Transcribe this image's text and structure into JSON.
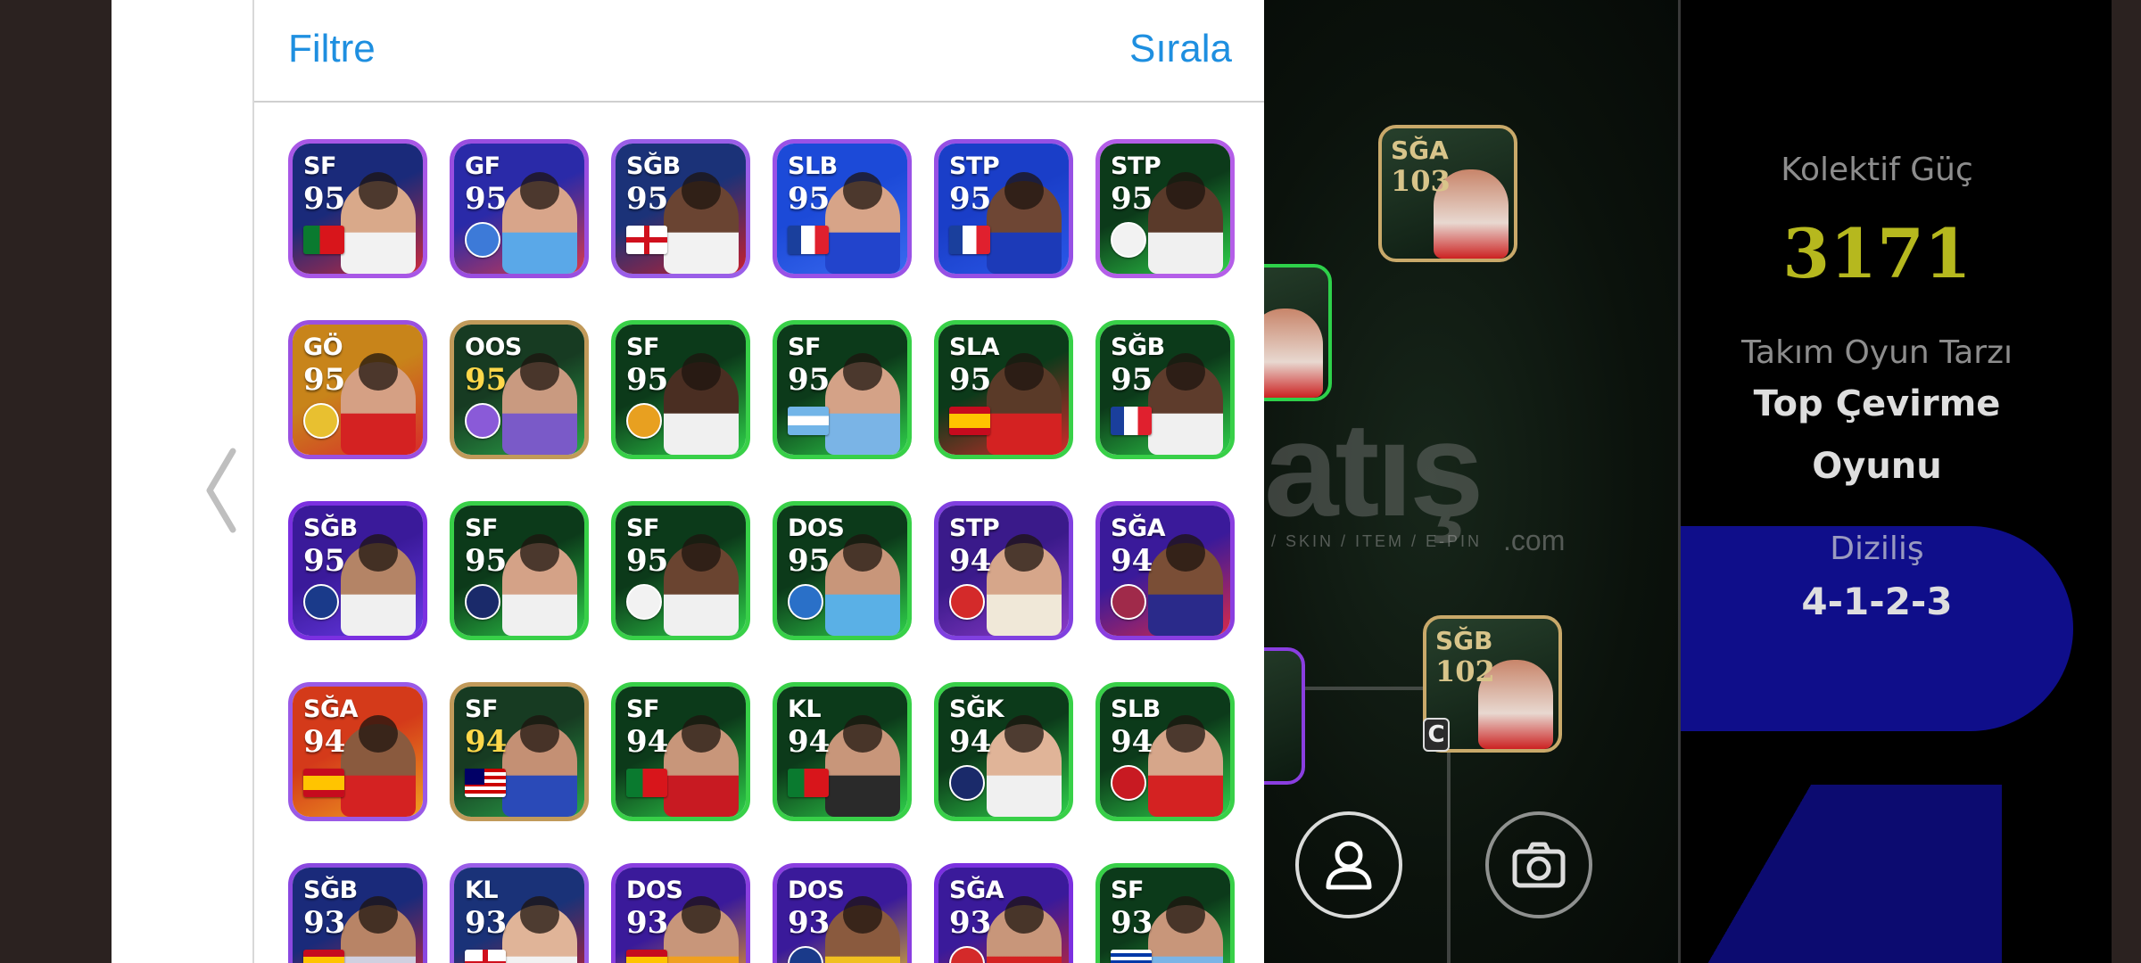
{
  "header": {
    "filter_label": "Filtre",
    "sort_label": "Sırala"
  },
  "cards": [
    {
      "pos": "SF",
      "rating": "95",
      "emblem": "flag-portugal",
      "border": "#a857e6",
      "bg": "#1a2a7a",
      "accent": "#cc2a3c",
      "skin": "#d9a98a",
      "shirt": "#f2f2f2"
    },
    {
      "pos": "GF",
      "rating": "95",
      "emblem": "club-crest",
      "border": "#9a4ee0",
      "bg": "#2a2aa8",
      "accent": "#d83a4a",
      "skin": "#d8a58a",
      "shirt": "#5aa8e8",
      "emblem_color": "#3d7ad8"
    },
    {
      "pos": "SĞB",
      "rating": "95",
      "emblem": "flag-england",
      "border": "#9a5ee8",
      "bg": "#1b3278",
      "accent": "#c8202e",
      "skin": "#6a4432",
      "shirt": "#f2f2f2"
    },
    {
      "pos": "SLB",
      "rating": "95",
      "emblem": "flag-france",
      "border": "#9a52e6",
      "bg": "#1c4ad8",
      "accent": "#3a6af0",
      "skin": "#d7a488",
      "shirt": "#2244cc"
    },
    {
      "pos": "STP",
      "rating": "95",
      "emblem": "flag-france",
      "border": "#9650e4",
      "bg": "#1a3ec8",
      "accent": "#2a58e8",
      "skin": "#6e4634",
      "shirt": "#1c3ab8"
    },
    {
      "pos": "STP",
      "rating": "95",
      "emblem": "club-crest",
      "border": "#b45ee8",
      "bg": "#0c3a1a",
      "accent": "#2ed14a",
      "skin": "#5a3a2a",
      "shirt": "#f0f0f0",
      "emblem_color": "#f2f2f2"
    },
    {
      "pos": "GÖ",
      "rating": "95",
      "emblem": "club-crest",
      "border": "#9a50e0",
      "bg": "#c8841a",
      "accent": "#d82a2a",
      "skin": "#d5a084",
      "shirt": "#d42222",
      "emblem_color": "#e8c030"
    },
    {
      "pos": "OOS",
      "rating": "95",
      "emblem": "club-crest",
      "border": "#c19a5a",
      "bg": "#173b22",
      "accent": "#2aa84a",
      "skin": "#c99a80",
      "shirt": "#7a5ac8",
      "emblem_color": "#8a5ad8",
      "gold": true
    },
    {
      "pos": "SF",
      "rating": "95",
      "emblem": "club-crest",
      "border": "#38d048",
      "bg": "#0c3a1a",
      "accent": "#2ed14a",
      "skin": "#4a2e22",
      "shirt": "#f0f0f0",
      "emblem_color": "#e8a020"
    },
    {
      "pos": "SF",
      "rating": "95",
      "emblem": "flag-argentina",
      "border": "#38d048",
      "bg": "#0c3a1a",
      "accent": "#2ed14a",
      "skin": "#d4a287",
      "shirt": "#7ab4e6"
    },
    {
      "pos": "SLA",
      "rating": "95",
      "emblem": "flag-spain",
      "border": "#38d048",
      "bg": "#0c3a1a",
      "accent": "#d42a2a",
      "skin": "#5a3a28",
      "shirt": "#d42222"
    },
    {
      "pos": "SĞB",
      "rating": "95",
      "emblem": "flag-france",
      "border": "#38d048",
      "bg": "#0c3a1a",
      "accent": "#2ed14a",
      "skin": "#5e3c2c",
      "shirt": "#f0f0f0"
    },
    {
      "pos": "SĞB",
      "rating": "95",
      "emblem": "club-crest",
      "border": "#7b30e0",
      "bg": "#3a1a9a",
      "accent": "#6a3ae8",
      "skin": "#b48466",
      "shirt": "#f0f0f0",
      "emblem_color": "#1a3a8a"
    },
    {
      "pos": "SF",
      "rating": "95",
      "emblem": "club-crest",
      "border": "#38d048",
      "bg": "#0c3a1a",
      "accent": "#2ed14a",
      "skin": "#d4a287",
      "shirt": "#f0f0f0",
      "emblem_color": "#1a2a6a"
    },
    {
      "pos": "SF",
      "rating": "95",
      "emblem": "club-crest",
      "border": "#38d048",
      "bg": "#0c3a1a",
      "accent": "#2ed14a",
      "skin": "#6a4430",
      "shirt": "#f0f0f0",
      "emblem_color": "#f2f2f2"
    },
    {
      "pos": "DOS",
      "rating": "95",
      "emblem": "club-crest",
      "border": "#38d048",
      "bg": "#0c3a1a",
      "accent": "#2ed14a",
      "skin": "#c8967a",
      "shirt": "#5ab0e6",
      "emblem_color": "#2a70c8"
    },
    {
      "pos": "STP",
      "rating": "94",
      "emblem": "club-crest",
      "border": "#8040e0",
      "bg": "#3a1a8a",
      "accent": "#8a3ac8",
      "skin": "#d6a68a",
      "shirt": "#f0e8d8",
      "emblem_color": "#d42a2a"
    },
    {
      "pos": "SĞA",
      "rating": "94",
      "emblem": "club-crest",
      "border": "#8a3ee0",
      "bg": "#3a1a9a",
      "accent": "#d82a4a",
      "skin": "#7a4e36",
      "shirt": "#2a2a8a",
      "emblem_color": "#a02a4a"
    },
    {
      "pos": "SĞA",
      "rating": "94",
      "emblem": "flag-spain",
      "border": "#9a5ae6",
      "bg": "#d43a1a",
      "accent": "#f0a020",
      "skin": "#8a5a3e",
      "shirt": "#d42222"
    },
    {
      "pos": "SF",
      "rating": "94",
      "emblem": "flag-malaysia",
      "border": "#c19a5a",
      "bg": "#173b22",
      "accent": "#2aa84a",
      "skin": "#c49074",
      "shirt": "#2a4ab8",
      "gold": true
    },
    {
      "pos": "SF",
      "rating": "94",
      "emblem": "flag-portugal",
      "border": "#38d048",
      "bg": "#0c3a1a",
      "accent": "#2ed14a",
      "skin": "#c8967a",
      "shirt": "#c81a22"
    },
    {
      "pos": "KL",
      "rating": "94",
      "emblem": "flag-portugal",
      "border": "#38d048",
      "bg": "#0c3a1a",
      "accent": "#2ed14a",
      "skin": "#c8967a",
      "shirt": "#2a2a2a"
    },
    {
      "pos": "SĞK",
      "rating": "94",
      "emblem": "club-crest",
      "border": "#38d048",
      "bg": "#0c3a1a",
      "accent": "#2ed14a",
      "skin": "#e0b498",
      "shirt": "#f0f0f0",
      "emblem_color": "#1a2a6a"
    },
    {
      "pos": "SLB",
      "rating": "94",
      "emblem": "club-crest",
      "border": "#38d048",
      "bg": "#0c3a1a",
      "accent": "#2ed14a",
      "skin": "#d6a68a",
      "shirt": "#d42222",
      "emblem_color": "#c81a22"
    },
    {
      "pos": "SĞB",
      "rating": "93",
      "emblem": "flag-spain",
      "border": "#8a48e0",
      "bg": "#1a2a7a",
      "accent": "#d42a3a",
      "skin": "#b88466",
      "shirt": "#d0d0e0"
    },
    {
      "pos": "KL",
      "rating": "93",
      "emblem": "flag-england",
      "border": "#9a5ee8",
      "bg": "#1a3278",
      "accent": "#c8202e",
      "skin": "#e0b498",
      "shirt": "#f2f2f2"
    },
    {
      "pos": "DOS",
      "rating": "93",
      "emblem": "flag-spain",
      "border": "#8a3ee0",
      "bg": "#3a1a9a",
      "accent": "#f0a020",
      "skin": "#c8967a",
      "shirt": "#f0a020"
    },
    {
      "pos": "DOS",
      "rating": "93",
      "emblem": "club-crest",
      "border": "#8a3ee0",
      "bg": "#3a1a9a",
      "accent": "#f0c020",
      "skin": "#8a5a3e",
      "shirt": "#f0c020",
      "emblem_color": "#1a3a8a"
    },
    {
      "pos": "SĞA",
      "rating": "93",
      "emblem": "club-crest",
      "border": "#7b30e0",
      "bg": "#3a1a9a",
      "accent": "#d42a2a",
      "skin": "#c8967a",
      "shirt": "#d42222",
      "emblem_color": "#d42a2a"
    },
    {
      "pos": "SF",
      "rating": "93",
      "emblem": "flag-uruguay",
      "border": "#38d048",
      "bg": "#0c3a1a",
      "accent": "#2ed14a",
      "skin": "#c8967a",
      "shirt": "#7ab4e6"
    }
  ],
  "pitch": {
    "watermark": "atış",
    "watermark_sub": "/ SKIN / ITEM / E-PIN",
    "watermark_com": ".com",
    "players": [
      {
        "pos": "SĞA",
        "rating": "103"
      },
      {
        "pos": "SĞB",
        "rating": "102"
      }
    ],
    "captain_badge": "C",
    "buttons": [
      {
        "icon": "profile-icon"
      },
      {
        "icon": "camera-icon"
      }
    ]
  },
  "info": {
    "collective_power_label": "Kolektif Güç",
    "collective_power_value": "3171",
    "collective_power_color": "#b6b81e",
    "playstyle_label": "Takım Oyun Tarzı",
    "playstyle_value_line1": "Top Çevirme",
    "playstyle_value_line2": "Oyunu",
    "formation_label": "Diziliş",
    "formation_value": "4-1-2-3"
  }
}
